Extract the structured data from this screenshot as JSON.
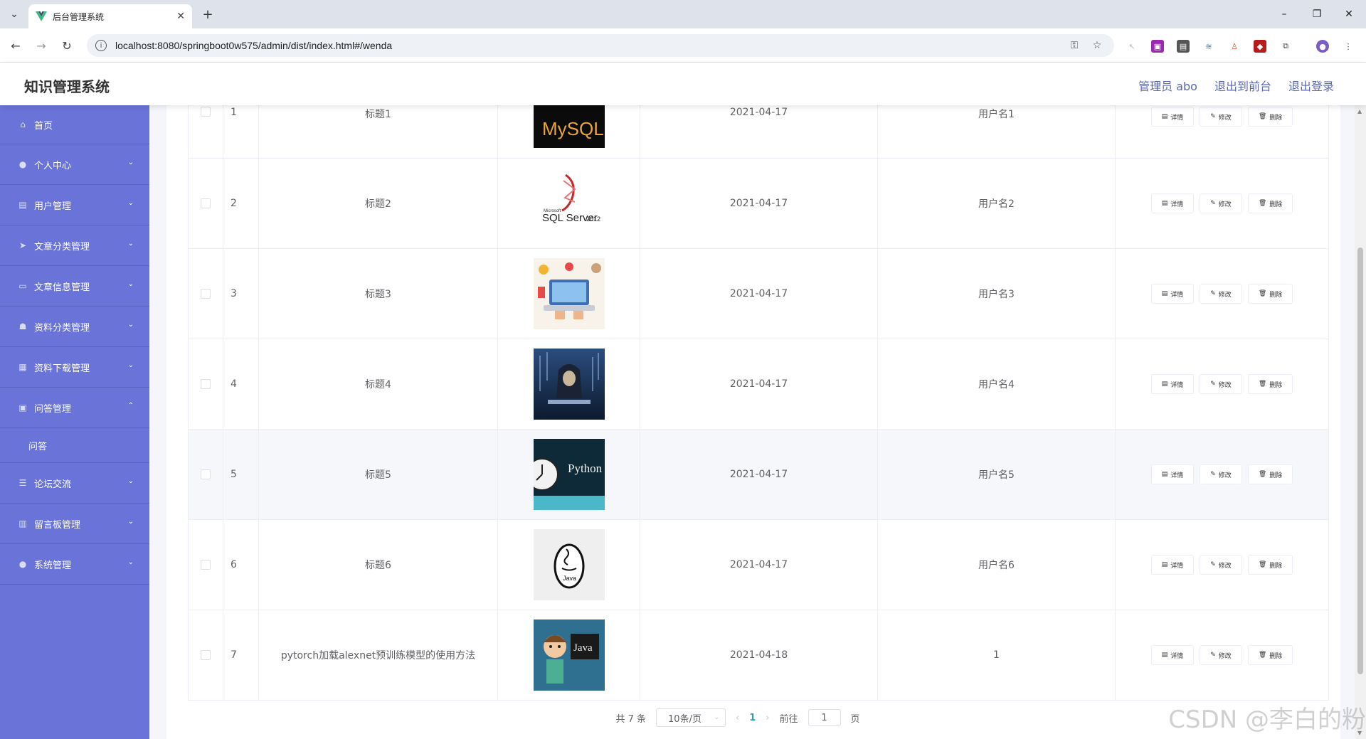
{
  "browser": {
    "tab_title": "后台管理系统",
    "url": "localhost:8080/springboot0w575/admin/dist/index.html#/wenda"
  },
  "header": {
    "app_title": "知识管理系统",
    "admin_label": "管理员 abo",
    "to_front": "退出到前台",
    "logout": "退出登录"
  },
  "sidebar": {
    "items": [
      {
        "label": "首页",
        "icon": "home-icon",
        "expandable": false
      },
      {
        "label": "个人中心",
        "icon": "user-icon",
        "expandable": true
      },
      {
        "label": "用户管理",
        "icon": "clipboard-icon",
        "expandable": true
      },
      {
        "label": "文章分类管理",
        "icon": "send-icon",
        "expandable": true
      },
      {
        "label": "文章信息管理",
        "icon": "card-icon",
        "expandable": true
      },
      {
        "label": "资料分类管理",
        "icon": "thumb-icon",
        "expandable": true
      },
      {
        "label": "资料下载管理",
        "icon": "grid-icon",
        "expandable": true
      },
      {
        "label": "问答管理",
        "icon": "clipboard-check-icon",
        "expandable": true,
        "expanded": true
      },
      {
        "label": "论坛交流",
        "icon": "menu-icon",
        "expandable": true
      },
      {
        "label": "留言板管理",
        "icon": "chart-icon",
        "expandable": true
      },
      {
        "label": "系统管理",
        "icon": "user-icon",
        "expandable": true
      }
    ],
    "submenu": {
      "label": "问答"
    }
  },
  "table": {
    "rows": [
      {
        "index": "1",
        "title": "标题1",
        "image": "mysql",
        "date": "2021-04-17",
        "user": "用户名1"
      },
      {
        "index": "2",
        "title": "标题2",
        "image": "sqlserver",
        "date": "2021-04-17",
        "user": "用户名2"
      },
      {
        "index": "3",
        "title": "标题3",
        "image": "laptop",
        "date": "2021-04-17",
        "user": "用户名3"
      },
      {
        "index": "4",
        "title": "标题4",
        "image": "hacker",
        "date": "2021-04-17",
        "user": "用户名4"
      },
      {
        "index": "5",
        "title": "标题5",
        "image": "python",
        "date": "2021-04-17",
        "user": "用户名5"
      },
      {
        "index": "6",
        "title": "标题6",
        "image": "java",
        "date": "2021-04-17",
        "user": "用户名6"
      },
      {
        "index": "7",
        "title": "pytorch加载alexnet预训练模型的使用方法",
        "image": "java-cartoon",
        "date": "2021-04-18",
        "user": "1"
      }
    ],
    "ops": {
      "detail": "详情",
      "edit": "修改",
      "delete": "删除"
    },
    "image_text": {
      "mysql": "MySQL",
      "sqlserver": "SQL Server",
      "sqlserver_version": "2012",
      "sqlserver_vendor": "Microsoft",
      "python": "Python",
      "java": "Java",
      "java_cartoon": "Java"
    }
  },
  "pager": {
    "total": "共 7 条",
    "page_size": "10条/页",
    "current": "1",
    "goto_prefix": "前往",
    "goto_value": "1",
    "goto_suffix": "页"
  },
  "watermark": "CSDN @李白的粉",
  "colors": {
    "sidebar": "#6a73d8",
    "header_link": "#5b68b1",
    "active_page": "#2aa3a3"
  }
}
